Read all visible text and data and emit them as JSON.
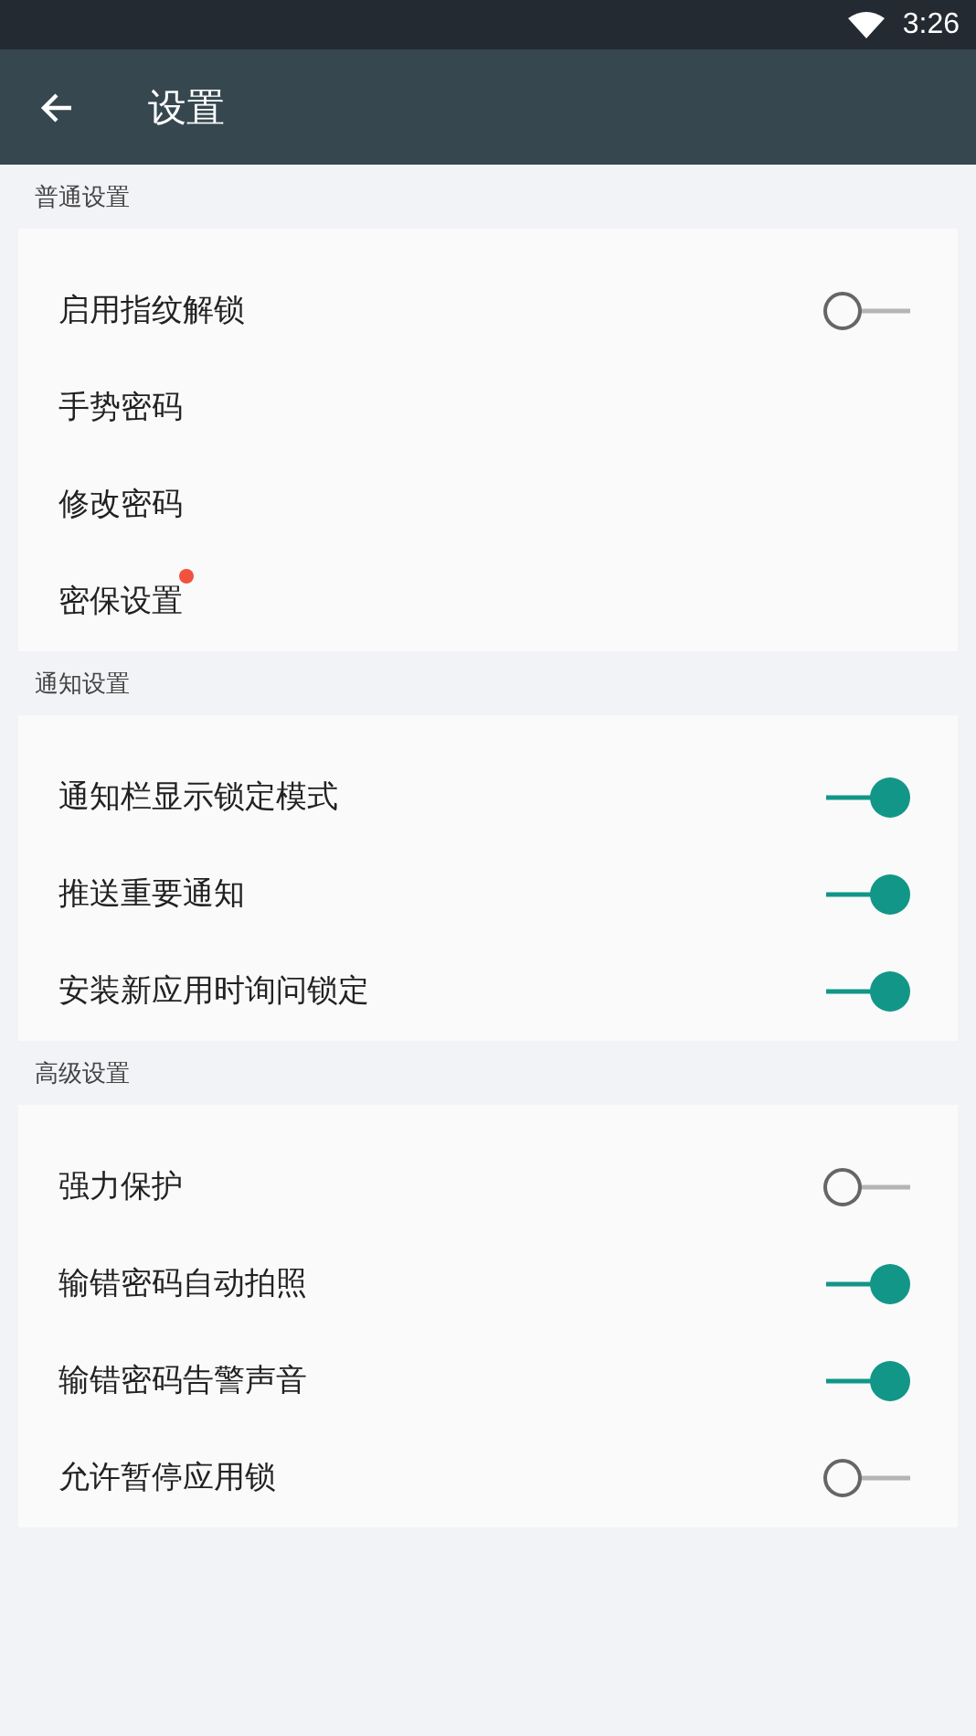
{
  "status_bar": {
    "time": "3:26"
  },
  "toolbar": {
    "title": "设置"
  },
  "sections": [
    {
      "title": "普通设置",
      "items": [
        {
          "kind": "switch",
          "label": "启用指纹解锁",
          "on": false
        },
        {
          "kind": "link",
          "label": "手势密码",
          "badge": false
        },
        {
          "kind": "link",
          "label": "修改密码",
          "badge": false
        },
        {
          "kind": "link",
          "label": "密保设置",
          "badge": true
        }
      ]
    },
    {
      "title": "通知设置",
      "items": [
        {
          "kind": "switch",
          "label": "通知栏显示锁定模式",
          "on": true
        },
        {
          "kind": "switch",
          "label": "推送重要通知",
          "on": true
        },
        {
          "kind": "switch",
          "label": "安装新应用时询问锁定",
          "on": true
        }
      ]
    },
    {
      "title": "高级设置",
      "items": [
        {
          "kind": "switch",
          "label": "强力保护",
          "on": false
        },
        {
          "kind": "switch",
          "label": "输错密码自动拍照",
          "on": true
        },
        {
          "kind": "switch",
          "label": "输错密码告警声音",
          "on": true
        },
        {
          "kind": "switch",
          "label": "允许暂停应用锁",
          "on": false
        }
      ]
    }
  ]
}
